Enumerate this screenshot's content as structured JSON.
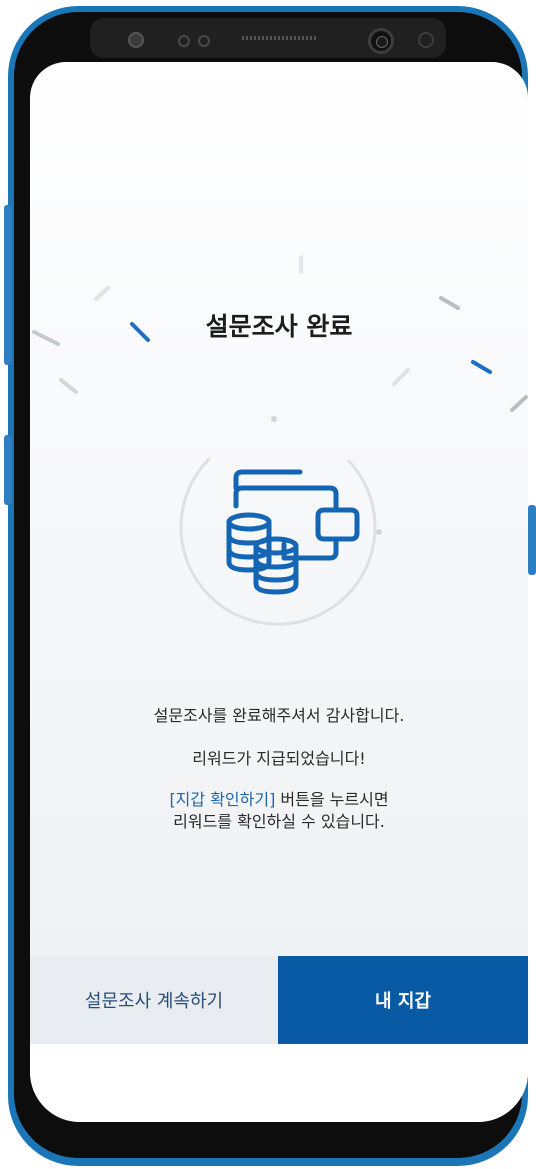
{
  "screen": {
    "title": "설문조사 완료",
    "messages": {
      "line1": "설문조사를 완료해주셔서 감사합니다.",
      "line2": "리워드가 지급되었습니다!",
      "line3_link": "[지갑 확인하기]",
      "line3_rest": " 버튼을 누르시면",
      "line4": "리워드를 확인하실 수 있습니다."
    },
    "icon": "wallet-coins-icon"
  },
  "actions": {
    "continue_label": "설문조사 계속하기",
    "wallet_label": "내 지갑"
  },
  "colors": {
    "accent": "#075aa3",
    "highlight_text": "#1f66b0",
    "secondary_button_bg": "#e9edf1",
    "frame": "#1b76b8"
  }
}
